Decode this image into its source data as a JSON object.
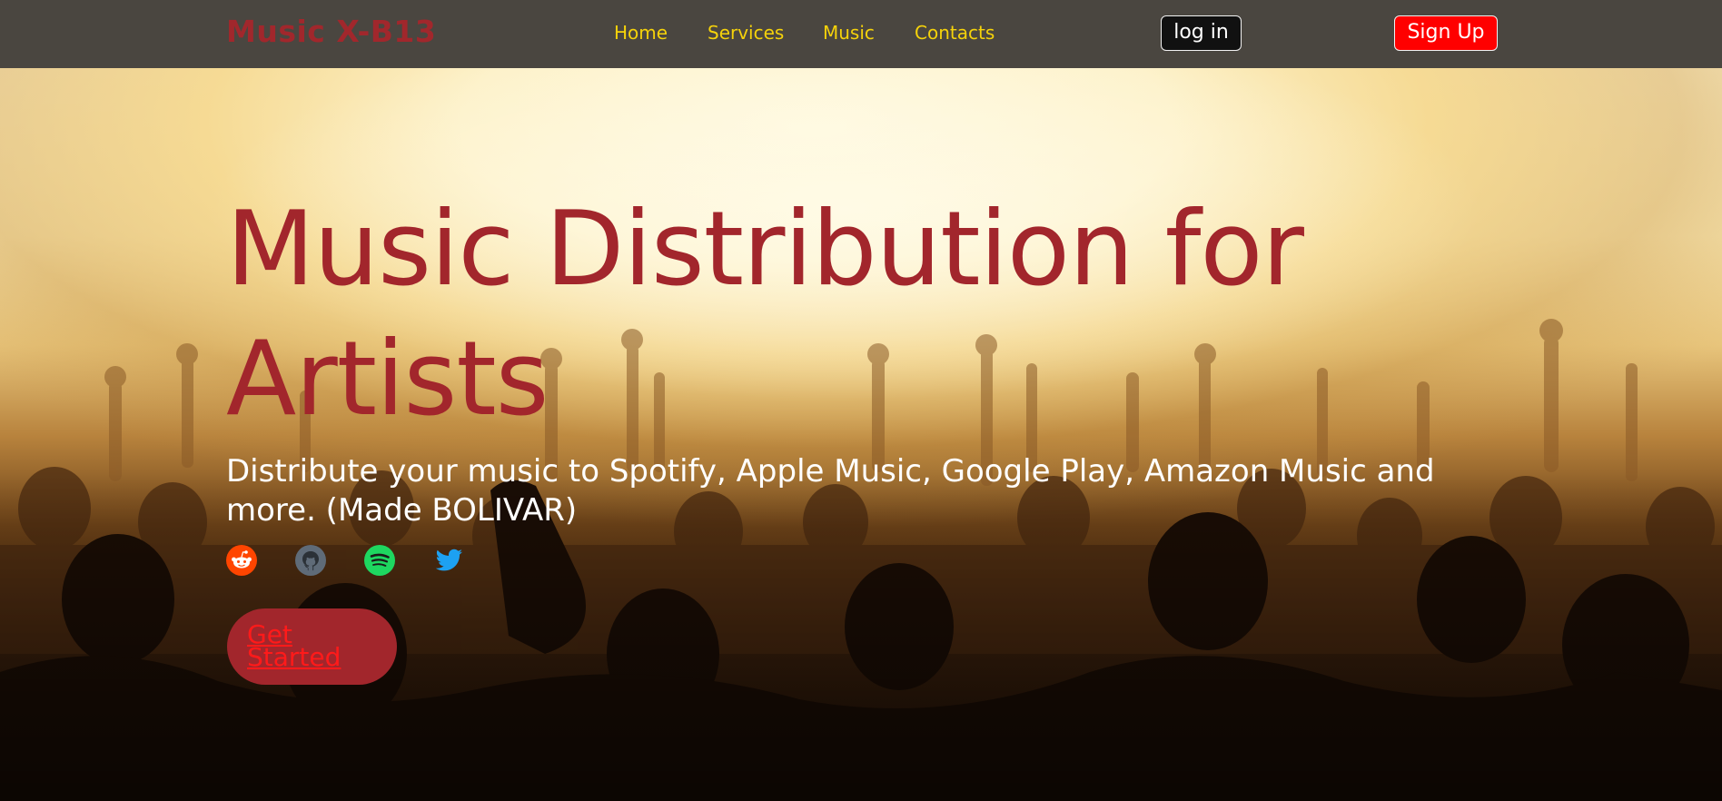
{
  "header": {
    "logo": "Music X-B13",
    "nav": {
      "home": "Home",
      "services": "Services",
      "music": "Music",
      "contacts": "Contacts"
    },
    "login_label": "log in",
    "signup_label": "Sign Up"
  },
  "hero": {
    "title": "Music Distribution for Artists",
    "subtitle": "Distribute your music to Spotify, Apple Music, Google Play, Amazon Music and more. (Made BOLIVAR)",
    "cta_label": "Get Started",
    "social_icons": [
      "reddit-icon",
      "github-icon",
      "spotify-icon",
      "twitter-icon"
    ]
  },
  "colors": {
    "navbar_bg": "#4a4640",
    "brand_red": "#a2262c",
    "nav_link": "#f5d20a",
    "signup_bg": "#ff0000",
    "login_bg": "#111111",
    "reddit": "#ff4500",
    "github": "#5f6b78",
    "spotify": "#1ed760",
    "twitter": "#1da1f2"
  }
}
